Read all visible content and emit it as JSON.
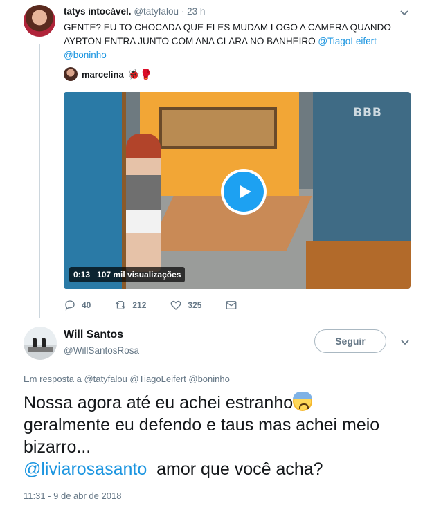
{
  "parent_tweet": {
    "author_name": "tatys intocável.",
    "author_handle": "@tatyfalou",
    "separator": "·",
    "time": "23 h",
    "text_main": "GENTE? EU TO CHOCADA QUE ELES MUDAM LOGO A CAMERA QUANDO AYRTON ENTRA JUNTO COM ANA CLARA NO BANHEIRO",
    "mention_1": "@TiagoLeifert",
    "mention_2": "@boninho",
    "quoted_author": "marcelina",
    "quoted_emojis": "🐞🥊",
    "video": {
      "watermark": "BBB",
      "duration": "0:13",
      "views": "107 mil visualizações"
    },
    "actions": {
      "replies": "40",
      "retweets": "212",
      "likes": "325"
    }
  },
  "reply_tweet": {
    "author_name": "Will Santos",
    "author_handle": "@WillSantosRosa",
    "follow_label": "Seguir",
    "replying_label": "Em resposta a",
    "replying_mentions": "@tatyfalou @TiagoLeifert @boninho",
    "line_1": "Nossa agora até eu achei estranho",
    "line_2": "geralmente eu defendo e taus mas achei meio bizarro...",
    "mention": "@liviarosasanto",
    "line_3": "amor que você acha?",
    "timestamp": "11:31 - 9 de abr de 2018"
  },
  "colors": {
    "link_blue": "#1b95e0",
    "play_blue": "#1da1f2",
    "muted_gray": "#657786",
    "text_dark": "#14171a"
  },
  "icons": [
    "chevron-down-icon",
    "play-icon",
    "reply-icon",
    "retweet-icon",
    "like-icon",
    "message-icon",
    "anxious-face-emoji"
  ]
}
